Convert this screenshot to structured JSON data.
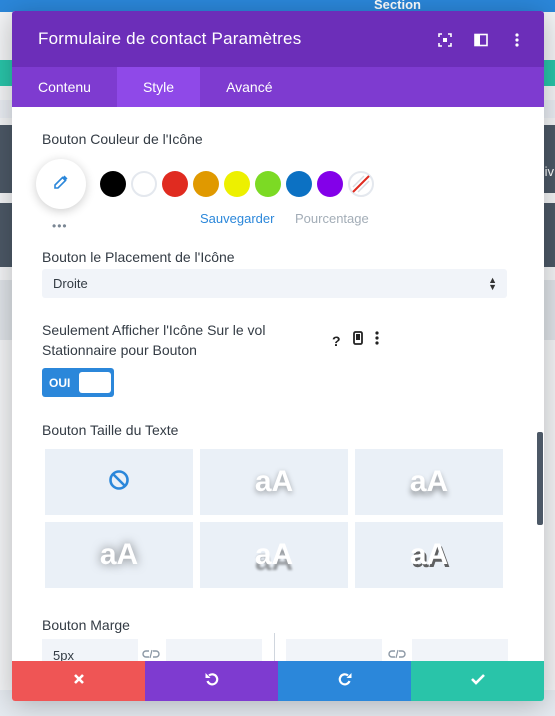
{
  "background": {
    "section_label": "Section",
    "right_letter": "iv"
  },
  "modal": {
    "title": "Formulaire de contact Paramètres",
    "header_icons": [
      "expand-icon",
      "split-view-icon",
      "more-vertical-icon"
    ],
    "tabs": [
      {
        "label": "Contenu",
        "active": false
      },
      {
        "label": "Style",
        "active": true
      },
      {
        "label": "Avancé",
        "active": false
      }
    ]
  },
  "icon_color": {
    "label": "Bouton Couleur de l'Icône",
    "swatches": [
      "#000000",
      "#ffffff",
      "#e02b20",
      "#e09900",
      "#edf000",
      "#7cda24",
      "#0c71c3",
      "#8300e9"
    ],
    "save_label": "Sauvegarder",
    "percent_label": "Pourcentage",
    "more": "•••"
  },
  "icon_placement": {
    "label": "Bouton le Placement de l'Icône",
    "value": "Droite"
  },
  "hover_icon": {
    "label": "Seulement Afficher l'Icône Sur le vol Stationnaire pour Bouton",
    "help": "?",
    "toggle_label": "OUI"
  },
  "text_size": {
    "label": "Bouton Taille du Texte",
    "preset_text": "aA"
  },
  "margin": {
    "label": "Bouton Marge",
    "value": "5px"
  },
  "colors": {
    "header": "#6c2eb9",
    "tabs": "#7e3bd0",
    "tab_active": "#8f49e8",
    "accent": "#2b87da",
    "cancel": "#ef5555",
    "undo": "#7e3bd0",
    "redo": "#2b87da",
    "save": "#29c4a9"
  }
}
